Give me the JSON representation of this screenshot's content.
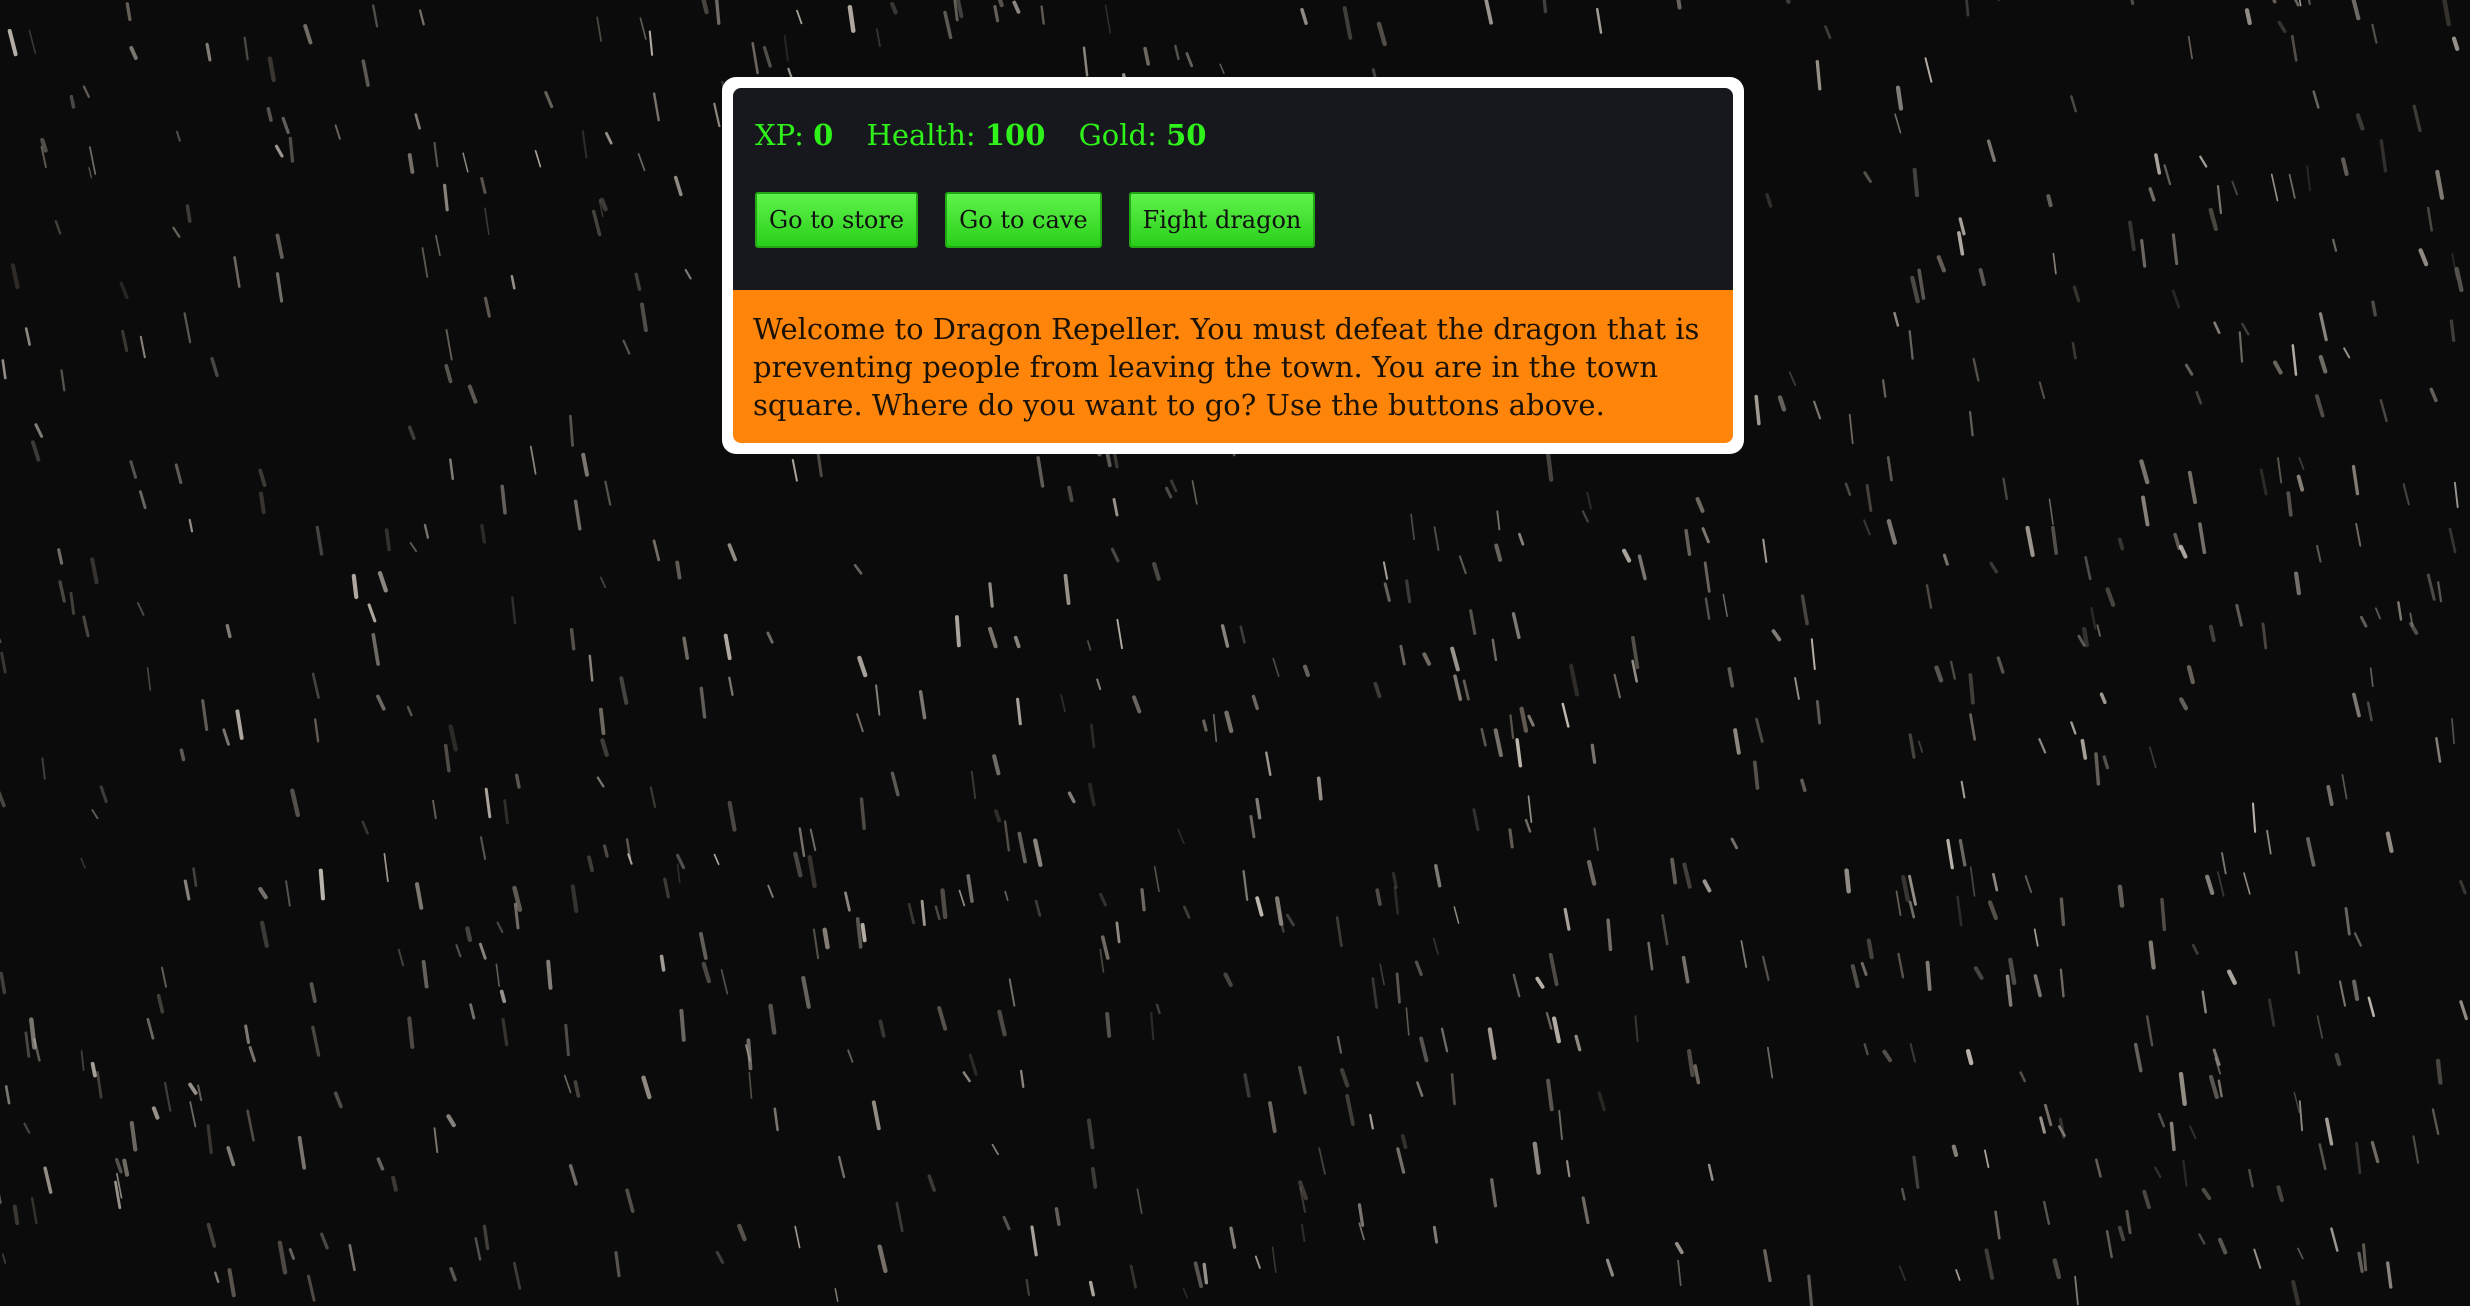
{
  "stats": [
    {
      "label": "XP:",
      "value": "0"
    },
    {
      "label": "Health:",
      "value": "100"
    },
    {
      "label": "Gold:",
      "value": "50"
    }
  ],
  "buttons": [
    {
      "label": "Go to store"
    },
    {
      "label": "Go to cave"
    },
    {
      "label": "Fight dragon"
    }
  ],
  "message": "Welcome to Dragon Repeller. You must defeat the dragon that is preventing people from leaving the town. You are in the town square. Where do you want to go? Use the buttons above.",
  "colors": {
    "background": "#0b0b0b",
    "panel": "#17181d",
    "accent_green": "#2ff21a",
    "message_orange": "#fe850a"
  }
}
